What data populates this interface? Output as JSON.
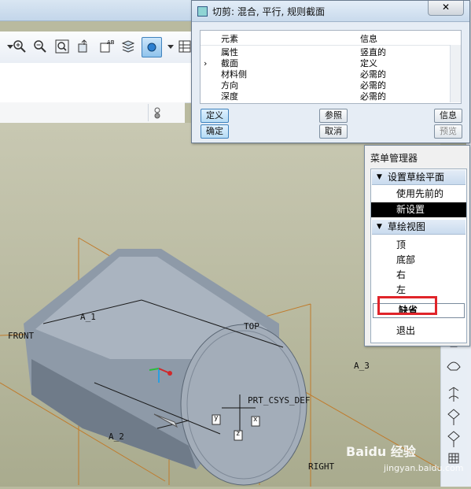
{
  "dialog": {
    "title": "切剪: 混合, 平行, 规则截面",
    "close_label": "✕",
    "columns": [
      "元素",
      "信息"
    ],
    "rows": [
      {
        "element": "属性",
        "info": "竖直的",
        "current": false
      },
      {
        "element": "截面",
        "info": "定义",
        "current": true
      },
      {
        "element": "材料侧",
        "info": "必需的",
        "current": false
      },
      {
        "element": "方向",
        "info": "必需的",
        "current": false
      },
      {
        "element": "深度",
        "info": "必需的",
        "current": false
      }
    ],
    "current_marker": "›",
    "buttons": {
      "define": "定义",
      "reference": "参照",
      "info": "信息",
      "ok": "确定",
      "cancel": "取消",
      "preview": "预览"
    }
  },
  "menu_manager": {
    "title": "菜单管理器",
    "section1": {
      "label": "设置草绘平面",
      "items": [
        "使用先前的",
        "新设置"
      ]
    },
    "section2": {
      "label": "草绘视图",
      "items": [
        "顶",
        "底部",
        "右",
        "左"
      ]
    },
    "default_item": "缺省",
    "exit_item": "退出"
  },
  "viewport": {
    "labels": {
      "front": "FRONT",
      "top": "TOP",
      "right": "RIGHT",
      "a1": "A_1",
      "a2": "A_2",
      "a3": "A_3",
      "csys": "PRT_CSYS_DEF",
      "x": "x",
      "y": "y",
      "z": "z"
    }
  },
  "watermark": {
    "main": "Baidu 经验",
    "sub": "jingyan.baidu.com"
  },
  "colors": {
    "accent": "#3f82bd",
    "highlight_box": "#e0242a",
    "datum": "#c07a2a"
  }
}
